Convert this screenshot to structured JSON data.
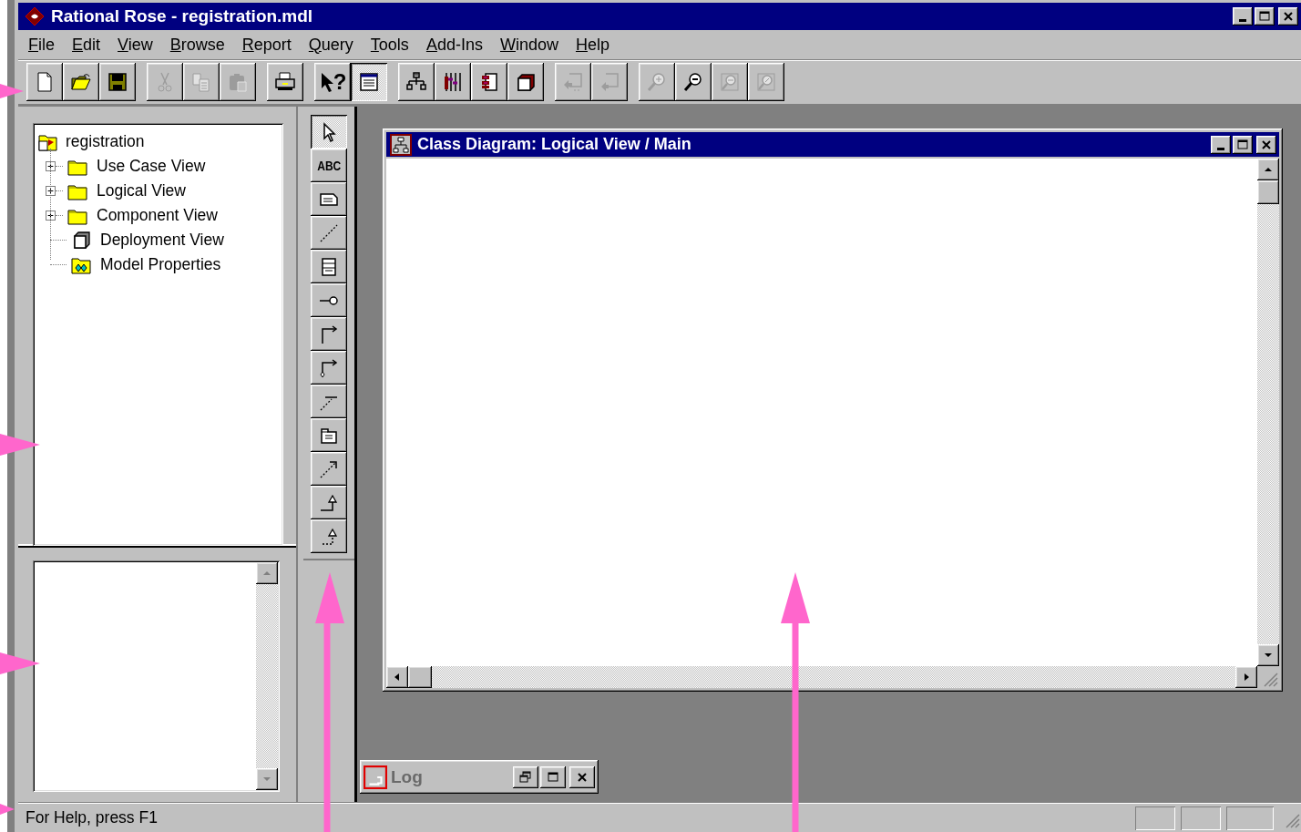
{
  "window": {
    "title": "Rational Rose - registration.mdl"
  },
  "menu": [
    {
      "label": "File"
    },
    {
      "label": "Edit"
    },
    {
      "label": "View"
    },
    {
      "label": "Browse"
    },
    {
      "label": "Report"
    },
    {
      "label": "Query"
    },
    {
      "label": "Tools"
    },
    {
      "label": "Add-Ins"
    },
    {
      "label": "Window"
    },
    {
      "label": "Help"
    }
  ],
  "toolbar": {
    "groups": [
      {
        "buttons": [
          {
            "kind": "new",
            "disabled": false,
            "pressed": false
          },
          {
            "kind": "open",
            "disabled": false,
            "pressed": false
          },
          {
            "kind": "save",
            "disabled": false,
            "pressed": false
          }
        ]
      },
      {
        "buttons": [
          {
            "kind": "cut",
            "disabled": true,
            "pressed": false
          },
          {
            "kind": "copy",
            "disabled": true,
            "pressed": false
          },
          {
            "kind": "paste",
            "disabled": true,
            "pressed": false
          }
        ]
      },
      {
        "buttons": [
          {
            "kind": "print",
            "disabled": false,
            "pressed": false
          }
        ]
      },
      {
        "buttons": [
          {
            "kind": "context-help",
            "glyph": "?",
            "disabled": false,
            "pressed": false
          },
          {
            "kind": "documentation",
            "disabled": false,
            "pressed": true
          }
        ]
      },
      {
        "buttons": [
          {
            "kind": "class-diagram",
            "disabled": false,
            "pressed": false
          },
          {
            "kind": "sequence-diagram",
            "disabled": false,
            "pressed": false
          },
          {
            "kind": "component-diagram",
            "disabled": false,
            "pressed": false
          },
          {
            "kind": "deployment-diagram",
            "disabled": false,
            "pressed": false
          }
        ]
      },
      {
        "buttons": [
          {
            "kind": "previous-diagram",
            "disabled": true,
            "pressed": false
          },
          {
            "kind": "parent-diagram",
            "disabled": true,
            "pressed": false
          }
        ]
      },
      {
        "buttons": [
          {
            "kind": "zoom-in",
            "disabled": true,
            "pressed": false
          },
          {
            "kind": "zoom-out",
            "disabled": false,
            "pressed": false
          },
          {
            "kind": "fit",
            "disabled": true,
            "pressed": false
          },
          {
            "kind": "undo-fit",
            "disabled": true,
            "pressed": false
          }
        ]
      }
    ]
  },
  "browser": {
    "root": {
      "label": "registration",
      "kind": "model",
      "children": [
        {
          "label": "Use Case View",
          "kind": "folder",
          "expandable": true
        },
        {
          "label": "Logical View",
          "kind": "folder",
          "expandable": true
        },
        {
          "label": "Component View",
          "kind": "folder",
          "expandable": true
        },
        {
          "label": "Deployment View",
          "kind": "node",
          "expandable": false
        },
        {
          "label": "Model Properties",
          "kind": "properties",
          "expandable": false
        }
      ]
    }
  },
  "toolbox": [
    {
      "kind": "pointer",
      "selected": true
    },
    {
      "kind": "text",
      "label": "ABC",
      "selected": false
    },
    {
      "kind": "note",
      "selected": false
    },
    {
      "kind": "anchor",
      "selected": false
    },
    {
      "kind": "class",
      "selected": false
    },
    {
      "kind": "interface",
      "selected": false
    },
    {
      "kind": "association",
      "selected": false
    },
    {
      "kind": "aggregation",
      "selected": false
    },
    {
      "kind": "link-attribute",
      "selected": false
    },
    {
      "kind": "package",
      "selected": false
    },
    {
      "kind": "dependency",
      "selected": false
    },
    {
      "kind": "generalization",
      "selected": false
    },
    {
      "kind": "realization",
      "selected": false
    }
  ],
  "diagram_window": {
    "title": "Class Diagram: Logical View / Main"
  },
  "log_window": {
    "title": "Log"
  },
  "status_bar": {
    "text": "For Help, press F1"
  }
}
